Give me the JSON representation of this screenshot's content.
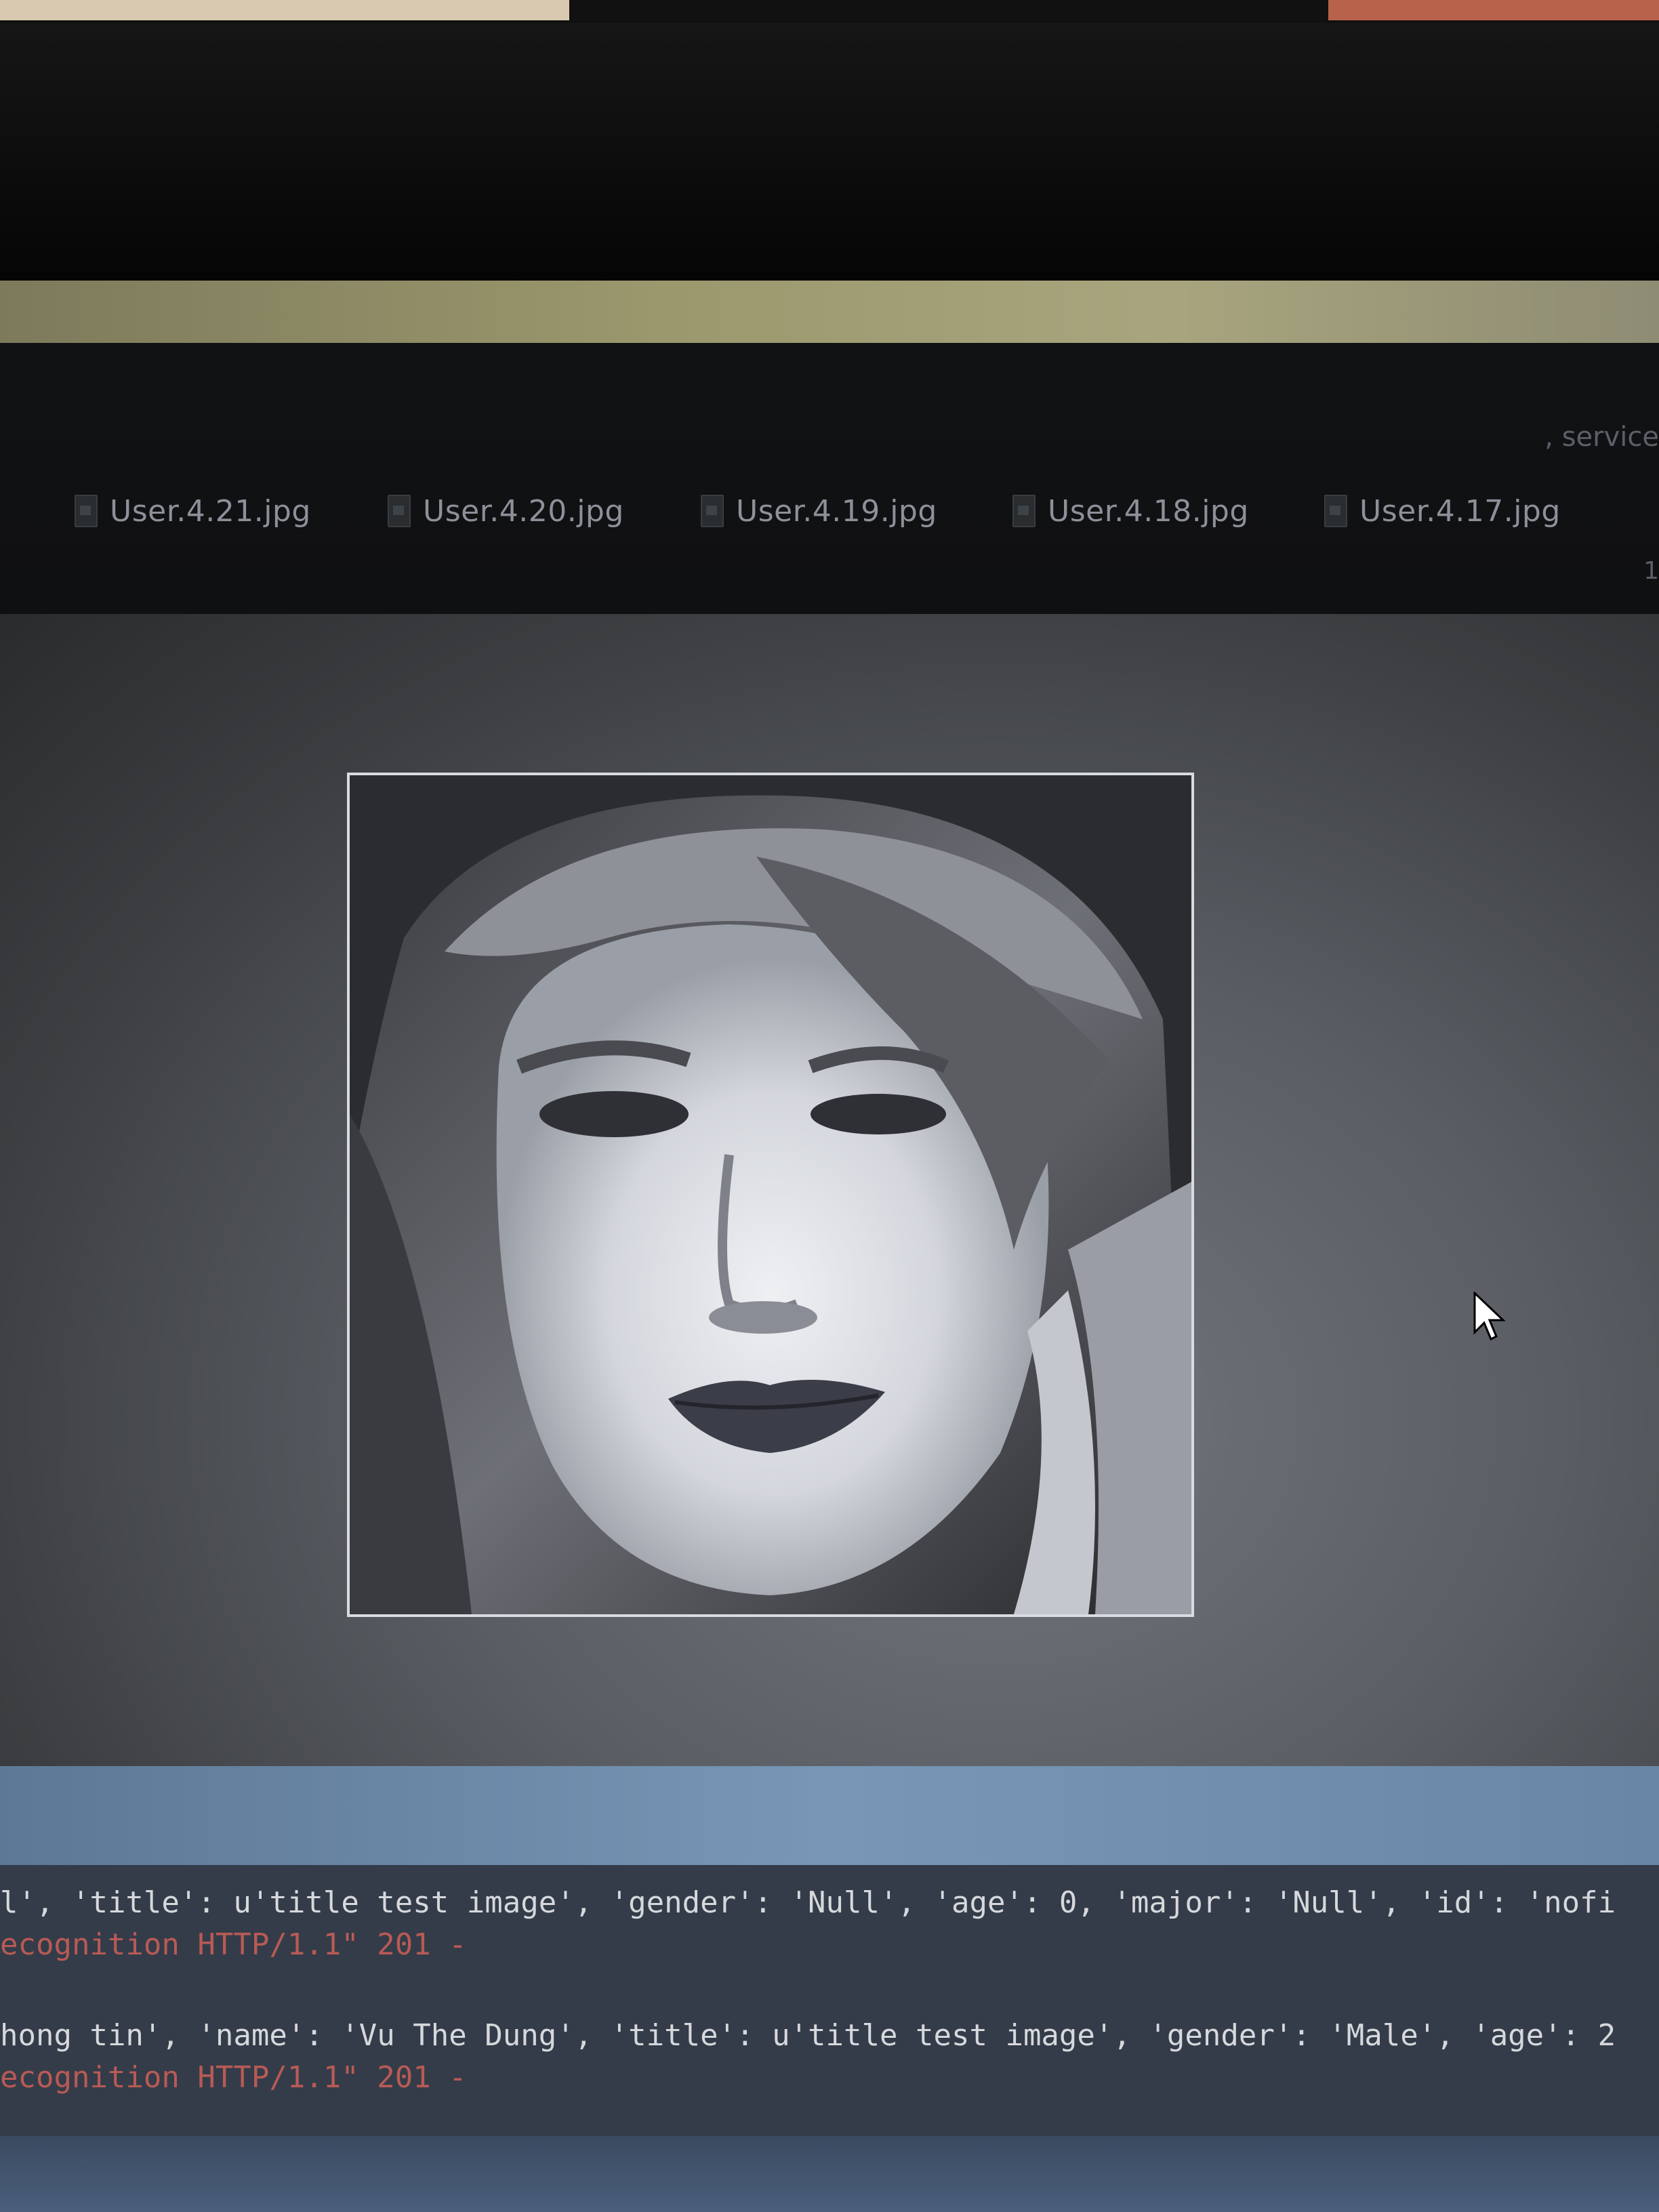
{
  "file_strip": {
    "service_text": ", service",
    "files": [
      {
        "name": "User.4.21.jpg",
        "icon": "image-file-icon"
      },
      {
        "name": "User.4.20.jpg",
        "icon": "image-file-icon"
      },
      {
        "name": "User.4.19.jpg",
        "icon": "image-file-icon"
      },
      {
        "name": "User.4.18.jpg",
        "icon": "image-file-icon"
      },
      {
        "name": "User.4.17.jpg",
        "icon": "image-file-icon"
      }
    ],
    "edge_number": "1"
  },
  "viewer": {
    "image": "grayscale-face-photo",
    "cursor": "mouse-pointer-icon"
  },
  "console": {
    "lines": [
      {
        "text": "l', 'title': u'title test image', 'gender': 'Null', 'age': 0, 'major': 'Null', 'id': 'nofi",
        "color": "#d6d8dc"
      },
      {
        "text": "ecognition HTTP/1.1\" 201 -",
        "color": "#b95a55"
      },
      {
        "text": "hong tin', 'name': 'Vu The Dung', 'title': u'title test image', 'gender': 'Male', 'age': 2",
        "color": "#d6d8dc"
      },
      {
        "text": "ecognition HTTP/1.1\" 201 -",
        "color": "#b95a55"
      }
    ]
  }
}
